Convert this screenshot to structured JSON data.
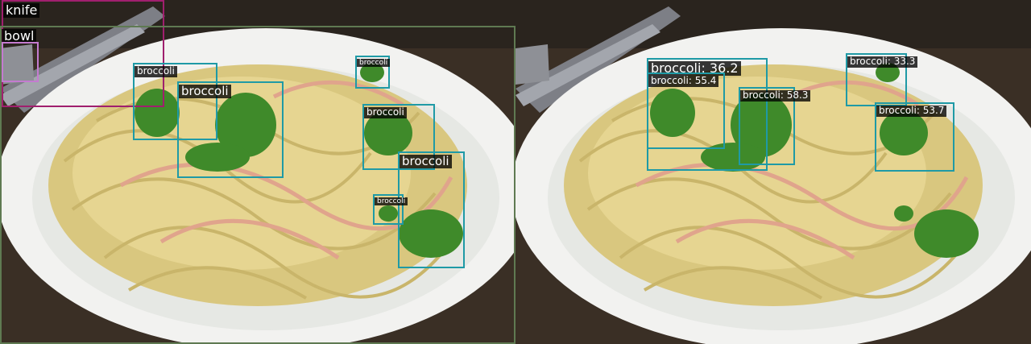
{
  "panels": [
    {
      "detections": [
        {
          "label": "knife",
          "color": "#a01f6e"
        },
        {
          "label": "bowl",
          "color": "#5f7a52"
        },
        {
          "label": "broccoli",
          "color": "#1f9aa6"
        },
        {
          "label": "broccoli",
          "color": "#1f9aa6"
        },
        {
          "label": "broccoli",
          "color": "#1f9aa6"
        },
        {
          "label": "broccoli",
          "color": "#1f9aa6"
        },
        {
          "label": "broccoli",
          "color": "#1f9aa6"
        },
        {
          "label": "broccoli",
          "color": "#1f9aa6"
        }
      ]
    },
    {
      "detections": [
        {
          "label": "broccoli: 36.2",
          "color": "#1f9aa6"
        },
        {
          "label": "broccoli: 55.4",
          "color": "#1f9aa6"
        },
        {
          "label": "broccoli: 58.3",
          "color": "#1f9aa6"
        },
        {
          "label": "broccoli: 33.3",
          "color": "#1f9aa6"
        },
        {
          "label": "broccoli: 53.7",
          "color": "#1f9aa6"
        }
      ]
    }
  ],
  "extra_box_colors": {
    "fork_box": "#c47bd0"
  }
}
